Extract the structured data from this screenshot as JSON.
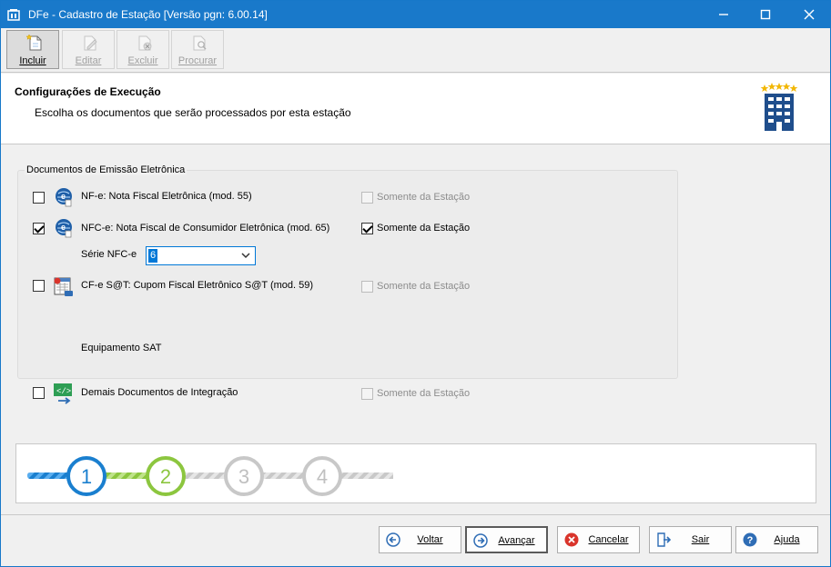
{
  "window": {
    "title": "DFe - Cadastro de Estação [Versão pgn: 6.00.14]"
  },
  "toolbar": {
    "items": [
      {
        "label": "Incluir",
        "icon": "new-document-icon",
        "state": "active"
      },
      {
        "label": "Editar",
        "icon": "edit-document-icon",
        "state": "disabled"
      },
      {
        "label": "Excluir",
        "icon": "delete-document-icon",
        "state": "disabled"
      },
      {
        "label": "Procurar",
        "icon": "search-document-icon",
        "state": "disabled"
      }
    ]
  },
  "header": {
    "title": "Configurações de Execução",
    "subtitle": "Escolha os documentos que serão processados por esta estação",
    "logo_icon": "building-stars-icon"
  },
  "group": {
    "title": "Documentos de Emissão Eletrônica",
    "nfe": {
      "label": "NF-e: Nota Fiscal Eletrônica (mod. 55)",
      "checked": false,
      "only_station_label": "Somente da Estação",
      "only_station_checked": false,
      "only_station_enabled": false
    },
    "nfce": {
      "label": "NFC-e: Nota Fiscal de Consumidor Eletrônica (mod. 65)",
      "checked": true,
      "only_station_label": "Somente da Estação",
      "only_station_checked": true,
      "only_station_enabled": true,
      "serie_label": "Série NFC-e",
      "serie_value": "6"
    },
    "cfe": {
      "label": "CF-e S@T: Cupom Fiscal Eletrônico S@T (mod. 59)",
      "checked": false,
      "only_station_label": "Somente da Estação",
      "only_station_checked": false,
      "only_station_enabled": false,
      "sat_label": "Equipamento SAT"
    }
  },
  "integration": {
    "label": "Demais Documentos de Integração",
    "checked": false,
    "only_station_label": "Somente da Estação",
    "only_station_checked": false,
    "only_station_enabled": false
  },
  "steps": {
    "items": [
      "1",
      "2",
      "3",
      "4"
    ],
    "current": 2,
    "colors": {
      "done": "#1a7fcf",
      "current": "#8cc63f",
      "pending": "#c8c8c8"
    }
  },
  "footer": {
    "buttons": [
      {
        "label": "Voltar",
        "icon": "arrow-left-circle-icon"
      },
      {
        "label": "Avançar",
        "icon": "arrow-right-circle-icon"
      },
      {
        "label": "Cancelar",
        "icon": "cancel-circle-icon"
      },
      {
        "label": "Sair",
        "icon": "exit-door-icon"
      },
      {
        "label": "Ajuda",
        "icon": "help-circle-icon"
      }
    ]
  }
}
